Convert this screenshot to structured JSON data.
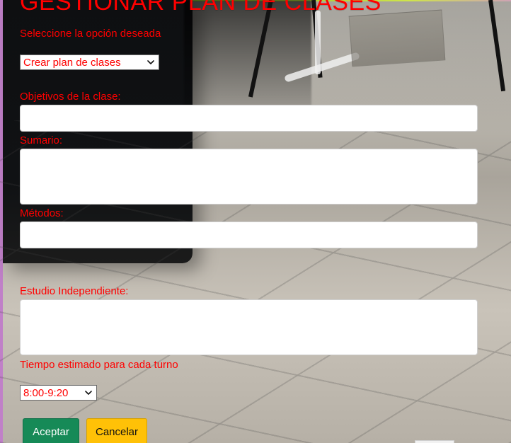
{
  "page": {
    "title": "GESTIONAR PLAN DE CLASES"
  },
  "form": {
    "option_label": "Seleccione la opción deseada",
    "option_select": {
      "value": "Crear plan de clases",
      "icon": "chevron-down-icon"
    },
    "fields": [
      {
        "label": "Objetivos de la clase:",
        "value": ""
      },
      {
        "label": "Sumario:",
        "value": ""
      },
      {
        "label": "Métodos:",
        "value": ""
      },
      {
        "label": "Estudio Independiente:",
        "value": ""
      }
    ],
    "time_label": "Tiempo estimado para cada turno",
    "time_select": {
      "value": "8:00-9:20",
      "icon": "chevron-down-icon"
    }
  },
  "actions": {
    "accept_label": "Aceptar",
    "cancel_label": "Cancelar"
  },
  "colors": {
    "text_red": "#ff0000",
    "accept_green": "#168a57",
    "cancel_yellow": "#ffc107"
  }
}
